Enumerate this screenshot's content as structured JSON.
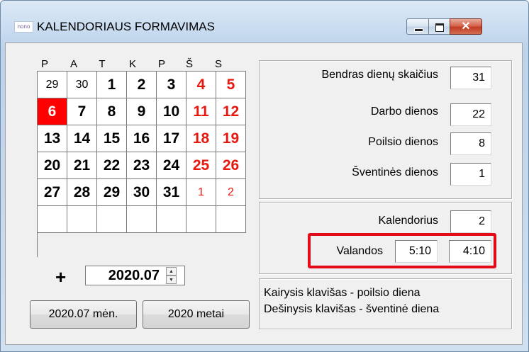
{
  "window": {
    "icon_text": "nono",
    "title": "KALENDORIAUS FORMAVIMAS",
    "controls": {
      "minimize": "minimize",
      "maximize": "maximize",
      "close": "✕"
    }
  },
  "calendar": {
    "weekdays": [
      "P",
      "A",
      "T",
      "K",
      "P",
      "Š",
      "S"
    ],
    "weeks": [
      [
        {
          "d": "29",
          "t": "other"
        },
        {
          "d": "30",
          "t": "other"
        },
        {
          "d": "1",
          "t": "work"
        },
        {
          "d": "2",
          "t": "work"
        },
        {
          "d": "3",
          "t": "work"
        },
        {
          "d": "4",
          "t": "rest"
        },
        {
          "d": "5",
          "t": "rest"
        }
      ],
      [
        {
          "d": "6",
          "t": "holiday"
        },
        {
          "d": "7",
          "t": "work"
        },
        {
          "d": "8",
          "t": "work"
        },
        {
          "d": "9",
          "t": "work"
        },
        {
          "d": "10",
          "t": "work"
        },
        {
          "d": "11",
          "t": "rest"
        },
        {
          "d": "12",
          "t": "rest"
        }
      ],
      [
        {
          "d": "13",
          "t": "work"
        },
        {
          "d": "14",
          "t": "work"
        },
        {
          "d": "15",
          "t": "work"
        },
        {
          "d": "16",
          "t": "work"
        },
        {
          "d": "17",
          "t": "work"
        },
        {
          "d": "18",
          "t": "rest"
        },
        {
          "d": "19",
          "t": "rest"
        }
      ],
      [
        {
          "d": "20",
          "t": "work"
        },
        {
          "d": "21",
          "t": "work"
        },
        {
          "d": "22",
          "t": "work"
        },
        {
          "d": "23",
          "t": "work"
        },
        {
          "d": "24",
          "t": "work"
        },
        {
          "d": "25",
          "t": "rest"
        },
        {
          "d": "26",
          "t": "rest"
        }
      ],
      [
        {
          "d": "27",
          "t": "work"
        },
        {
          "d": "28",
          "t": "work"
        },
        {
          "d": "29",
          "t": "work"
        },
        {
          "d": "30",
          "t": "work"
        },
        {
          "d": "31",
          "t": "work"
        },
        {
          "d": "1",
          "t": "other-rest"
        },
        {
          "d": "2",
          "t": "other-rest"
        }
      ],
      [
        {
          "d": "",
          "t": "empty"
        },
        {
          "d": "",
          "t": "empty"
        },
        {
          "d": "",
          "t": "empty"
        },
        {
          "d": "",
          "t": "empty"
        },
        {
          "d": "",
          "t": "empty"
        },
        {
          "d": "",
          "t": "empty"
        },
        {
          "d": "",
          "t": "empty"
        }
      ]
    ],
    "plus_label": "+",
    "period_value": "2020.07",
    "month_button": "2020.07 mėn.",
    "year_button": "2020 metai"
  },
  "stats": {
    "total_label": "Bendras dienų skaičius",
    "total_value": "31",
    "work_label": "Darbo dienos",
    "work_value": "22",
    "rest_label": "Poilsio dienos",
    "rest_value": "8",
    "holiday_label": "Šventinės dienos",
    "holiday_value": "1"
  },
  "calendar_info": {
    "calendar_label": "Kalendorius",
    "calendar_value": "2",
    "hours_label": "Valandos",
    "hours_value_1": "5:10",
    "hours_value_2": "4:10"
  },
  "help": {
    "line1": "Kairysis klavišas - poilsio diena",
    "line2": "Dešinysis klavišas - šventinė diena"
  },
  "colors": {
    "rest_day": "#e8180e",
    "holiday_bg": "#ff0000",
    "highlight_border": "#e30b18"
  }
}
